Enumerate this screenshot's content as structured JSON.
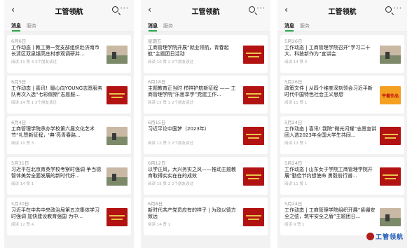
{
  "header": {
    "back_icon": "‹",
    "title": "工管领航",
    "more_icon": "···"
  },
  "tabs": [
    "消息",
    "服务"
  ],
  "panels": [
    {
      "cards": [
        {
          "date": "6月6日",
          "title": "工作动态 | 教工第一党支部组织赴济南市长清区双泉镇高庄村参观调研并...",
          "meta": "阅读 11  赞 4  3个朋友读过",
          "thumb": "photo"
        },
        {
          "date": "6月5日",
          "title": "工作动态 | 喜讯！暖心向YOUNG志愿服务队再次入选“七彩假期”志愿服...",
          "meta": "阅读 14  赞 1  3个朋友读过",
          "thumb": "red"
        },
        {
          "date": "6月4日",
          "title": "工商管理学院承办学校第六届文化艺术节“礼赞新征程，‘典’亮青春路...",
          "meta": "阅读 10  赞 3",
          "thumb": "photo"
        },
        {
          "date": "5月31日",
          "title": "习近平在北京育英学校考察时强调 争当德智体美劳全面发展的新时代好...",
          "meta": "阅读 14  赞 1",
          "thumb": "photo"
        },
        {
          "date": "5月30日",
          "title": "习近平在中共中央政治局第五次集体学习时强调 加快建设教育强国 为中...",
          "meta": "阅读 12  赞 4",
          "thumb": "red"
        }
      ]
    },
    {
      "cards": [
        {
          "date": "星期五",
          "title": "工商管理学院开展“就业领航，青春起航”主题团日活动",
          "meta": "阅读 10  赞 2  2个朋友读过",
          "thumb": "red"
        },
        {
          "date": "6月18日",
          "title": "主题教育正当时 栉祥护航新征程 —— 工商管理学院“乐思享学”党建工作...",
          "meta": "阅读 15  赞 1  2个朋友读过",
          "thumb": "red"
        },
        {
          "date": "6月15日",
          "title": "习近平论中国梦（2023年）",
          "meta": "阅读 12  赞 3  2个朋友读过",
          "thumb": "red"
        },
        {
          "date": "6月12日",
          "title": "以学正风，大兴务实之风——推动主题教育取得实实在在的成效",
          "meta": "阅读 15  赞 2  2个朋友读过",
          "thumb": "red"
        },
        {
          "date": "6月8日",
          "title": "新时代共产党员应有的样子 | 为政以德方致远",
          "meta": "阅读 14  赞 1",
          "thumb": "red"
        }
      ]
    },
    {
      "cards": [
        {
          "date": "5月26日",
          "title": "工作动态 | 工商管理学院召开“学习二十大、科技新作为”宣讲会",
          "meta": "阅读 14  赞 3",
          "thumb": "photo"
        },
        {
          "date": "5月26日",
          "title": "政策文件 | 从四个维度深刻领会习近平新时代中国特色社会主义思想",
          "meta": "阅读 11  赞 1",
          "thumb": "orange",
          "thumb_text": "平著作品"
        },
        {
          "date": "5月24日",
          "title": "工作动态 | 喜讯! 我院“微光闪耀”志愿宣讲团入选2023年全国大学生共同...",
          "meta": "阅读 13  赞 1",
          "thumb": "red"
        },
        {
          "date": "5月24日",
          "title": "工作动态 | 山东女子学院工商管理学院开展“勤俭节约想使命 勇毅前行谱...",
          "meta": "阅读 11  赞 1",
          "thumb": "red"
        },
        {
          "date": "5月24日",
          "title": "工作动态 | 工商管理学院组织开展“紧绷安全之弦，筑牢安全之盾”主题团日...",
          "meta": "阅读 9  赞 1",
          "thumb": "photo"
        }
      ]
    }
  ],
  "watermark": {
    "text": "工管领航",
    "icon": "wechat-logo"
  }
}
